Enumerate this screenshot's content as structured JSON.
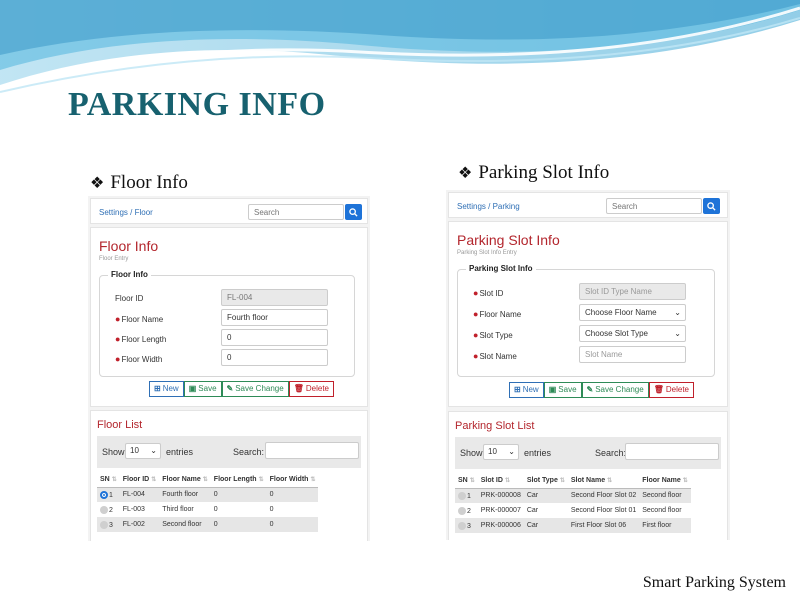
{
  "slide_title": "PARKING INFO",
  "footer": "Smart Parking System",
  "colors": {
    "title_teal": "#17616f",
    "form_red": "#b3262d",
    "link_blue": "#2f6fb5",
    "primary_blue": "#1e73d8"
  },
  "floor": {
    "heading": "Floor Info",
    "breadcrumb": "Settings / Floor",
    "search_placeholder": "Search",
    "form_title": "Floor Info",
    "form_subtitle": "Floor Entry",
    "legend": "Floor Info",
    "fields": [
      {
        "label": "Floor ID",
        "required": false,
        "value": "FL-004"
      },
      {
        "label": "Floor Name",
        "required": true,
        "value": "Fourth floor"
      },
      {
        "label": "Floor Length",
        "required": true,
        "value": "0"
      },
      {
        "label": "Floor Width",
        "required": true,
        "value": "0"
      }
    ],
    "buttons": {
      "new": "New",
      "save": "Save",
      "change": "Save Change",
      "delete": "Delete"
    },
    "list_title": "Floor List",
    "show_label": "Show",
    "entries_value": "10",
    "entries_label": "entries",
    "search_label": "Search:",
    "columns": [
      "SN",
      "Floor ID",
      "Floor Name",
      "Floor Length",
      "Floor Width"
    ],
    "rows": [
      {
        "sn": "1",
        "id": "FL-004",
        "name": "Fourth floor",
        "length": "0",
        "width": "0",
        "selected": true
      },
      {
        "sn": "2",
        "id": "FL-003",
        "name": "Third floor",
        "length": "0",
        "width": "0",
        "selected": false
      },
      {
        "sn": "3",
        "id": "FL-002",
        "name": "Second floor",
        "length": "0",
        "width": "0",
        "selected": false
      }
    ]
  },
  "slot": {
    "heading": "Parking Slot Info",
    "breadcrumb": "Settings / Parking",
    "search_placeholder": "Search",
    "form_title": "Parking Slot Info",
    "form_subtitle": "Parking Slot Info Entry",
    "legend": "Parking Slot Info",
    "fields": [
      {
        "label": "Slot ID",
        "required": true,
        "placeholder": "Slot ID Type Name"
      },
      {
        "label": "Floor Name",
        "required": true,
        "value": "Choose Floor Name"
      },
      {
        "label": "Slot Type",
        "required": true,
        "value": "Choose Slot Type"
      },
      {
        "label": "Slot Name",
        "required": true,
        "placeholder": "Slot Name"
      }
    ],
    "buttons": {
      "new": "New",
      "save": "Save",
      "change": "Save Change",
      "delete": "Delete"
    },
    "list_title": "Parking Slot List",
    "show_label": "Show",
    "entries_value": "10",
    "entries_label": "entries",
    "search_label": "Search:",
    "columns": [
      "SN",
      "Slot ID",
      "Slot Type",
      "Slot Name",
      "Floor Name"
    ],
    "rows": [
      {
        "sn": "1",
        "id": "PRK-000008",
        "type": "Car",
        "name": "Second Floor Slot 02",
        "floor": "Second floor"
      },
      {
        "sn": "2",
        "id": "PRK-000007",
        "type": "Car",
        "name": "Second Floor Slot 01",
        "floor": "Second floor"
      },
      {
        "sn": "3",
        "id": "PRK-000006",
        "type": "Car",
        "name": "First Floor Slot 06",
        "floor": "First floor"
      }
    ]
  }
}
